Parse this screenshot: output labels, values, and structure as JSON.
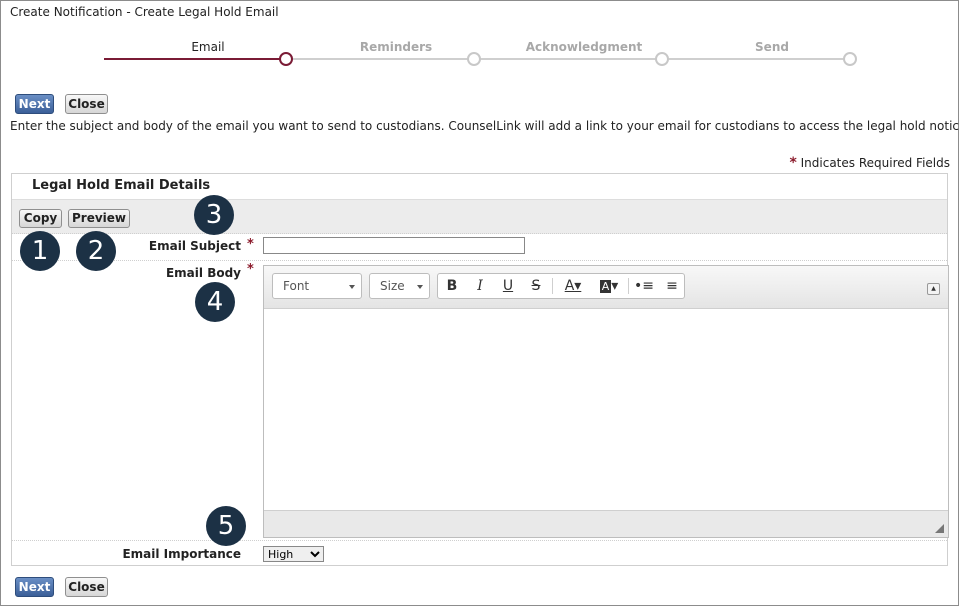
{
  "window": {
    "title": "Create Notification - Create Legal Hold Email"
  },
  "wizard": {
    "steps": [
      {
        "label": "Email",
        "active": true
      },
      {
        "label": "Reminders",
        "active": false
      },
      {
        "label": "Acknowledgment",
        "active": false
      },
      {
        "label": "Send",
        "active": false
      }
    ],
    "accent_color": "#7a1b35"
  },
  "actions": {
    "next_label": "Next",
    "close_label": "Close"
  },
  "instructions": "Enter the subject and body of the email you want to send to custodians. CounselLink will add a link to your email for custodians to access the legal hold notice itself.",
  "required_note": {
    "star": "*",
    "text": "Indicates Required Fields"
  },
  "panel": {
    "title": "Legal Hold Email Details",
    "copy_label": "Copy",
    "preview_label": "Preview"
  },
  "fields": {
    "subject_label": "Email Subject",
    "subject_value": "",
    "body_label": "Email Body",
    "importance_label": "Email Importance",
    "importance_value": "High",
    "required_star": "*"
  },
  "editor": {
    "font_label": "Font",
    "size_label": "Size",
    "tools": [
      "bold-icon",
      "italic-icon",
      "underline-icon",
      "strikethrough-icon",
      "text-color-icon",
      "background-color-icon",
      "bulleted-list-icon",
      "numbered-list-icon"
    ]
  },
  "callouts": [
    "1",
    "2",
    "3",
    "4",
    "5"
  ]
}
